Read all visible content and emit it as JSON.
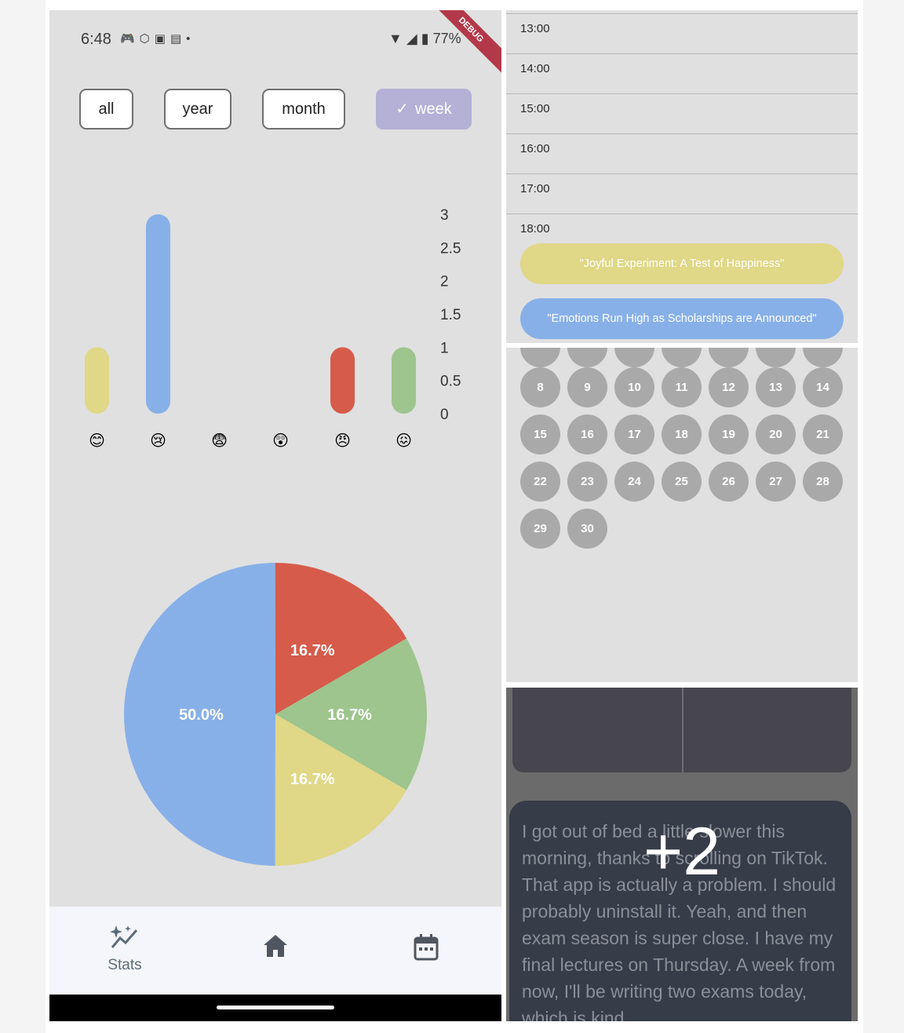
{
  "status_bar": {
    "time": "6:48",
    "battery": "77%",
    "debug_banner": "DEBUG"
  },
  "filters": [
    {
      "label": "all",
      "selected": false
    },
    {
      "label": "year",
      "selected": false
    },
    {
      "label": "month",
      "selected": false
    },
    {
      "label": "week",
      "selected": true,
      "check_glyph": "✓"
    }
  ],
  "mood_colors": {
    "happy": "#e0d787",
    "sad": "#88b0e8",
    "fearful": "#c9a0dc",
    "surprised": "#f0b45a",
    "angry": "#d65b4a",
    "disgusted": "#9dc58d"
  },
  "chart_data": [
    {
      "type": "bar",
      "categories": [
        "😊",
        "😢",
        "😨",
        "😲",
        "😠",
        "😖"
      ],
      "values": [
        1,
        3,
        0,
        0,
        1,
        1
      ],
      "y_ticks": [
        "3",
        "2.5",
        "2",
        "1.5",
        "1",
        "0.5",
        "0"
      ],
      "ylim": [
        0,
        3
      ],
      "grid": false,
      "y_axis_side": "right"
    },
    {
      "type": "pie",
      "slices": [
        {
          "label": "50.0%",
          "value": 50.0,
          "color": "#88b0e8"
        },
        {
          "label": "16.7%",
          "value": 16.7,
          "color": "#d65b4a"
        },
        {
          "label": "16.7%",
          "value": 16.7,
          "color": "#9dc58d"
        },
        {
          "label": "16.7%",
          "value": 16.7,
          "color": "#e0d787"
        }
      ]
    }
  ],
  "nav": {
    "stats_label": "Stats",
    "items": [
      {
        "name": "stats",
        "icon": "sparkle-chart-icon",
        "label": "Stats"
      },
      {
        "name": "home",
        "icon": "home-icon"
      },
      {
        "name": "calendar",
        "icon": "calendar-icon"
      }
    ]
  },
  "timeline": {
    "hours": [
      "13:00",
      "14:00",
      "15:00",
      "16:00",
      "17:00",
      "18:00"
    ],
    "events": [
      {
        "title": "\"Joyful Experiment: A Test of Happiness\"",
        "color": "#e0d787"
      },
      {
        "title": "\"Emotions Run High as Scholarships are Announced\"",
        "color": "#88b0e8"
      }
    ]
  },
  "calendar": {
    "days": [
      "8",
      "9",
      "10",
      "11",
      "12",
      "13",
      "14",
      "15",
      "16",
      "17",
      "18",
      "19",
      "20",
      "21",
      "22",
      "23",
      "24",
      "25",
      "26",
      "27",
      "28",
      "29",
      "30"
    ]
  },
  "journal": {
    "text": "I got out of bed a little slower this morning, thanks to scrolling on TikTok. That app is actually a problem. I should probably uninstall it. Yeah, and then exam season is super close. I have my final lectures on Thursday. A week from now, I'll be writing two exams today, which is kind",
    "overlay_count": "+2"
  }
}
